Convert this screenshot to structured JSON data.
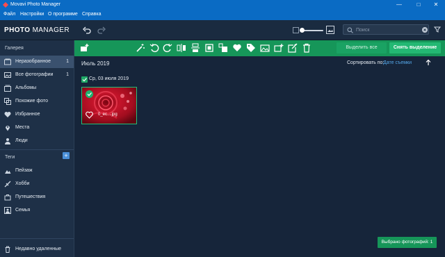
{
  "window": {
    "title": "Movavi Photo Manager",
    "controls": [
      "minimize-icon",
      "maximize-icon",
      "close-icon"
    ]
  },
  "menu": [
    "Файл",
    "Настройки",
    "О программе",
    "Справка"
  ],
  "brand": {
    "bold": "PHOTO",
    "regular": "MANAGER"
  },
  "header": {
    "icons": [
      "undo-icon",
      "redo-icon",
      "small-thumb-icon",
      "large-thumb-icon"
    ]
  },
  "search": {
    "placeholder": "Поиск",
    "value": ""
  },
  "sidebar": {
    "gallery_heading": "Галерея",
    "items": [
      {
        "label": "Неразобранное",
        "count": "1",
        "icon": "unsorted-icon",
        "active": true
      },
      {
        "label": "Все фотографии",
        "count": "1",
        "icon": "photos-icon",
        "active": false
      },
      {
        "label": "Альбомы",
        "count": "",
        "icon": "albums-icon",
        "active": false
      },
      {
        "label": "Похожие фото",
        "count": "",
        "icon": "similar-icon",
        "active": false
      },
      {
        "label": "Избранное",
        "count": "",
        "icon": "heart-icon",
        "active": false
      },
      {
        "label": "Места",
        "count": "",
        "icon": "location-icon",
        "active": false
      },
      {
        "label": "Люди",
        "count": "",
        "icon": "people-icon",
        "active": false
      }
    ],
    "tags_heading": "Теги",
    "tags": [
      {
        "label": "Пейзаж",
        "icon": "tag-icon"
      },
      {
        "label": "Хобби",
        "icon": "tag-icon"
      },
      {
        "label": "Путешествия",
        "icon": "tag-icon"
      },
      {
        "label": "Семья",
        "icon": "tag-icon"
      }
    ],
    "trash": {
      "label": "Недавно удаленные",
      "icon": "trash-icon"
    }
  },
  "toolbar": {
    "icons": [
      "add-photos-icon",
      "magic-wand-icon",
      "rotate-left-icon",
      "rotate-right-icon",
      "flip-horizontal-icon",
      "flip-vertical-icon",
      "crop-icon",
      "resize-icon",
      "favorite-icon",
      "tag-icon",
      "album-icon",
      "add-to-album-icon",
      "share-icon",
      "delete-icon"
    ],
    "select_all": "Выделить все",
    "deselect": "Снять выделение"
  },
  "content": {
    "month": "Июль 2019",
    "sort_label": "Сортировать по:",
    "sort_value": "Дате съемки",
    "day_label": "Ср, 03 июля 2019",
    "photo": {
      "name": "0_ec....jpg",
      "selected": true
    }
  },
  "status": {
    "selected": "Выбрано фотографий: 1"
  },
  "colors": {
    "accent_green": "#169659",
    "title_blue": "#0a6bc4",
    "link_blue": "#55a7e8"
  }
}
